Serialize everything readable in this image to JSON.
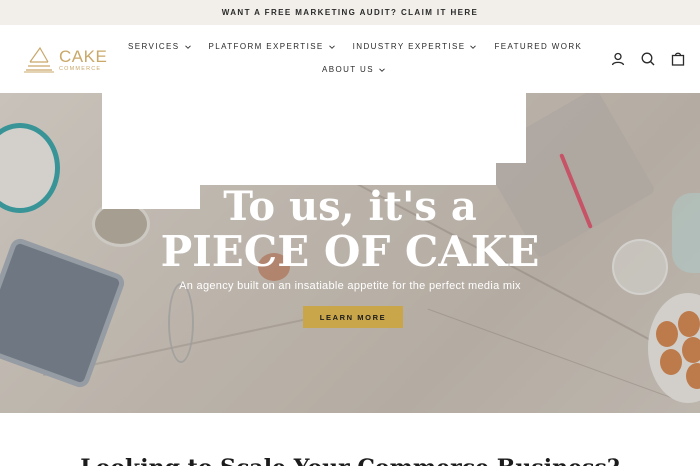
{
  "announcement": {
    "text": "WANT A FREE MARKETING AUDIT? CLAIM IT HERE"
  },
  "logo": {
    "main": "CAKE",
    "sub": "COMMERCE"
  },
  "nav": {
    "row1": [
      {
        "label": "SERVICES",
        "has_dropdown": true
      },
      {
        "label": "PLATFORM EXPERTISE",
        "has_dropdown": true
      },
      {
        "label": "INDUSTRY EXPERTISE",
        "has_dropdown": true
      },
      {
        "label": "FEATURED WORK",
        "has_dropdown": false
      }
    ],
    "row2": [
      {
        "label": "ABOUT US",
        "has_dropdown": true
      }
    ]
  },
  "header_icons": [
    "user-icon",
    "search-icon",
    "cart-icon"
  ],
  "hero": {
    "title_line1": "To us, it's a",
    "title_line2": "PIECE OF CAKE",
    "subtitle": "An agency built on an insatiable appetite for the perfect media mix",
    "cta_label": "LEARN MORE"
  },
  "below": {
    "heading": "Looking to Scale Your Commerce Business?"
  },
  "colors": {
    "accent": "#c9a64a",
    "logo": "#c9a86a",
    "announce_bg": "#f2efea"
  }
}
